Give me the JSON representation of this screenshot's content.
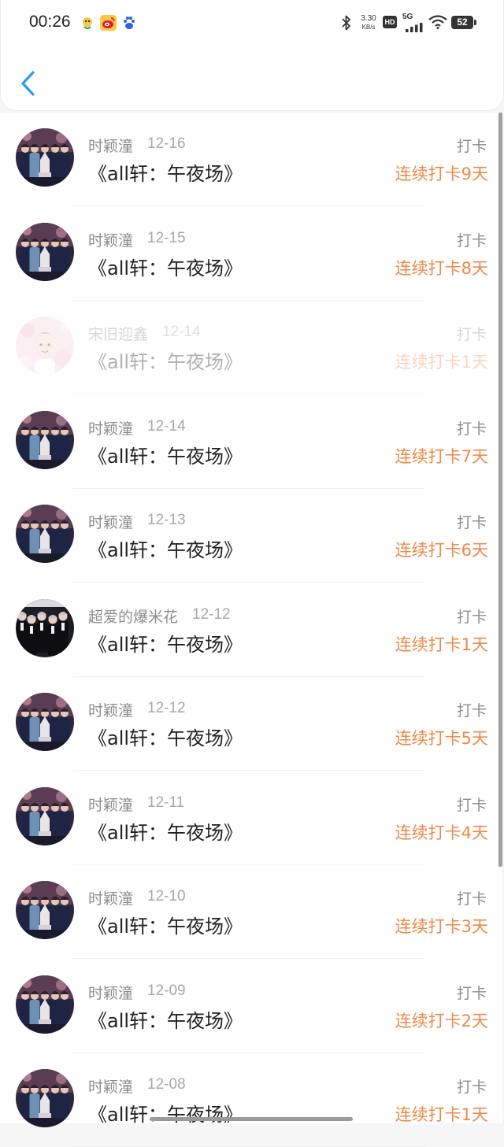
{
  "status_bar": {
    "time": "00:26",
    "apps": [
      {
        "icon": "app-notification-icon",
        "color": "#e8b33a"
      },
      {
        "icon": "weibo-icon",
        "color": "#e6162d"
      },
      {
        "icon": "baidu-paw-icon",
        "color": "#2f5fe3"
      }
    ],
    "network_speed": "3.30",
    "network_speed_unit": "KB/s",
    "hd_badge": "HD",
    "network_type": "5G",
    "battery": "52"
  },
  "header": {
    "back_icon": "chevron-left-icon",
    "accent_color": "#2e9bf0"
  },
  "list": {
    "items": [
      {
        "username": "时颖潼",
        "date": "12-16",
        "title": "《all轩：午夜场》",
        "type": "打卡",
        "streak": "连续打卡9天",
        "avatar": "avatar-group-photo",
        "faded": false
      },
      {
        "username": "时颖潼",
        "date": "12-15",
        "title": "《all轩：午夜场》",
        "type": "打卡",
        "streak": "连续打卡8天",
        "avatar": "avatar-group-photo",
        "faded": false
      },
      {
        "username": "宋旧迎鑫",
        "date": "12-14",
        "title": "《all轩：午夜场》",
        "type": "打卡",
        "streak": "连续打卡1天",
        "avatar": "avatar-pink-portrait",
        "faded": true
      },
      {
        "username": "时颖潼",
        "date": "12-14",
        "title": "《all轩：午夜场》",
        "type": "打卡",
        "streak": "连续打卡7天",
        "avatar": "avatar-group-photo",
        "faded": false
      },
      {
        "username": "时颖潼",
        "date": "12-13",
        "title": "《all轩：午夜场》",
        "type": "打卡",
        "streak": "连续打卡6天",
        "avatar": "avatar-group-photo",
        "faded": false
      },
      {
        "username": "超爱的爆米花",
        "date": "12-12",
        "title": "《all轩：午夜场》",
        "type": "打卡",
        "streak": "连续打卡1天",
        "avatar": "avatar-dark-group",
        "faded": false
      },
      {
        "username": "时颖潼",
        "date": "12-12",
        "title": "《all轩：午夜场》",
        "type": "打卡",
        "streak": "连续打卡5天",
        "avatar": "avatar-group-photo",
        "faded": false
      },
      {
        "username": "时颖潼",
        "date": "12-11",
        "title": "《all轩：午夜场》",
        "type": "打卡",
        "streak": "连续打卡4天",
        "avatar": "avatar-group-photo",
        "faded": false
      },
      {
        "username": "时颖潼",
        "date": "12-10",
        "title": "《all轩：午夜场》",
        "type": "打卡",
        "streak": "连续打卡3天",
        "avatar": "avatar-group-photo",
        "faded": false
      },
      {
        "username": "时颖潼",
        "date": "12-09",
        "title": "《all轩：午夜场》",
        "type": "打卡",
        "streak": "连续打卡2天",
        "avatar": "avatar-group-photo",
        "faded": false
      },
      {
        "username": "时颖潼",
        "date": "12-08",
        "title": "《all轩：午夜场》",
        "type": "打卡",
        "streak": "连续打卡1天",
        "avatar": "avatar-group-photo",
        "faded": false
      }
    ]
  },
  "colors": {
    "streak": "#ec8a4a",
    "secondary_text": "#8c8c8c",
    "primary_text": "#222222"
  }
}
